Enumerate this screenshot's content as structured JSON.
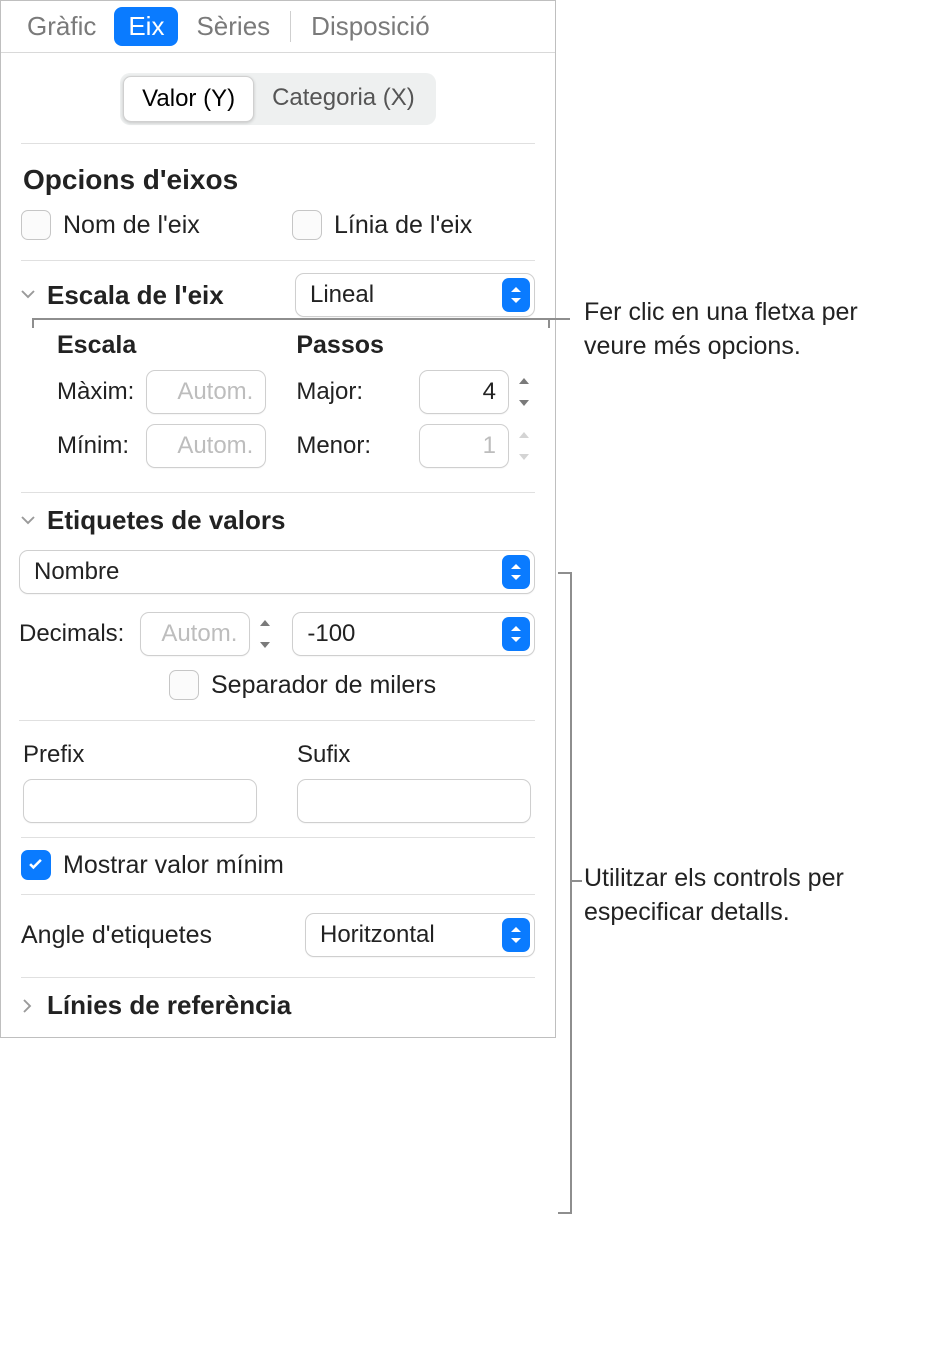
{
  "tabs": {
    "grafic": "Gràfic",
    "eix": "Eix",
    "series": "Sèries",
    "disposicio": "Disposició"
  },
  "segmented": {
    "value_y": "Valor (Y)",
    "category_x": "Categoria (X)"
  },
  "axis_options": {
    "heading": "Opcions d'eixos",
    "axis_name_label": "Nom de l'eix",
    "axis_line_label": "Línia de l'eix"
  },
  "scale": {
    "title": "Escala de l'eix",
    "select_value": "Lineal",
    "escala_heading": "Escala",
    "passos_heading": "Passos",
    "max_label": "Màxim:",
    "max_placeholder": "Autom.",
    "min_label": "Mínim:",
    "min_placeholder": "Autom.",
    "major_label": "Major:",
    "major_value": "4",
    "minor_label": "Menor:",
    "minor_value": "1"
  },
  "value_labels": {
    "title": "Etiquetes de valors",
    "format_select": "Nombre",
    "decimals_label": "Decimals:",
    "decimals_placeholder": "Autom.",
    "negative_select": "-100",
    "thousands_label": "Separador de milers",
    "prefix_label": "Prefix",
    "suffix_label": "Sufix"
  },
  "show_min": {
    "label": "Mostrar valor mínim"
  },
  "label_angle": {
    "label": "Angle d'etiquetes",
    "value": "Horitzontal"
  },
  "ref_lines": {
    "title": "Línies de referència"
  },
  "annotations": {
    "arrow": "Fer clic en una fletxa per veure més opcions.",
    "controls": "Utilitzar els controls per especificar detalls."
  }
}
